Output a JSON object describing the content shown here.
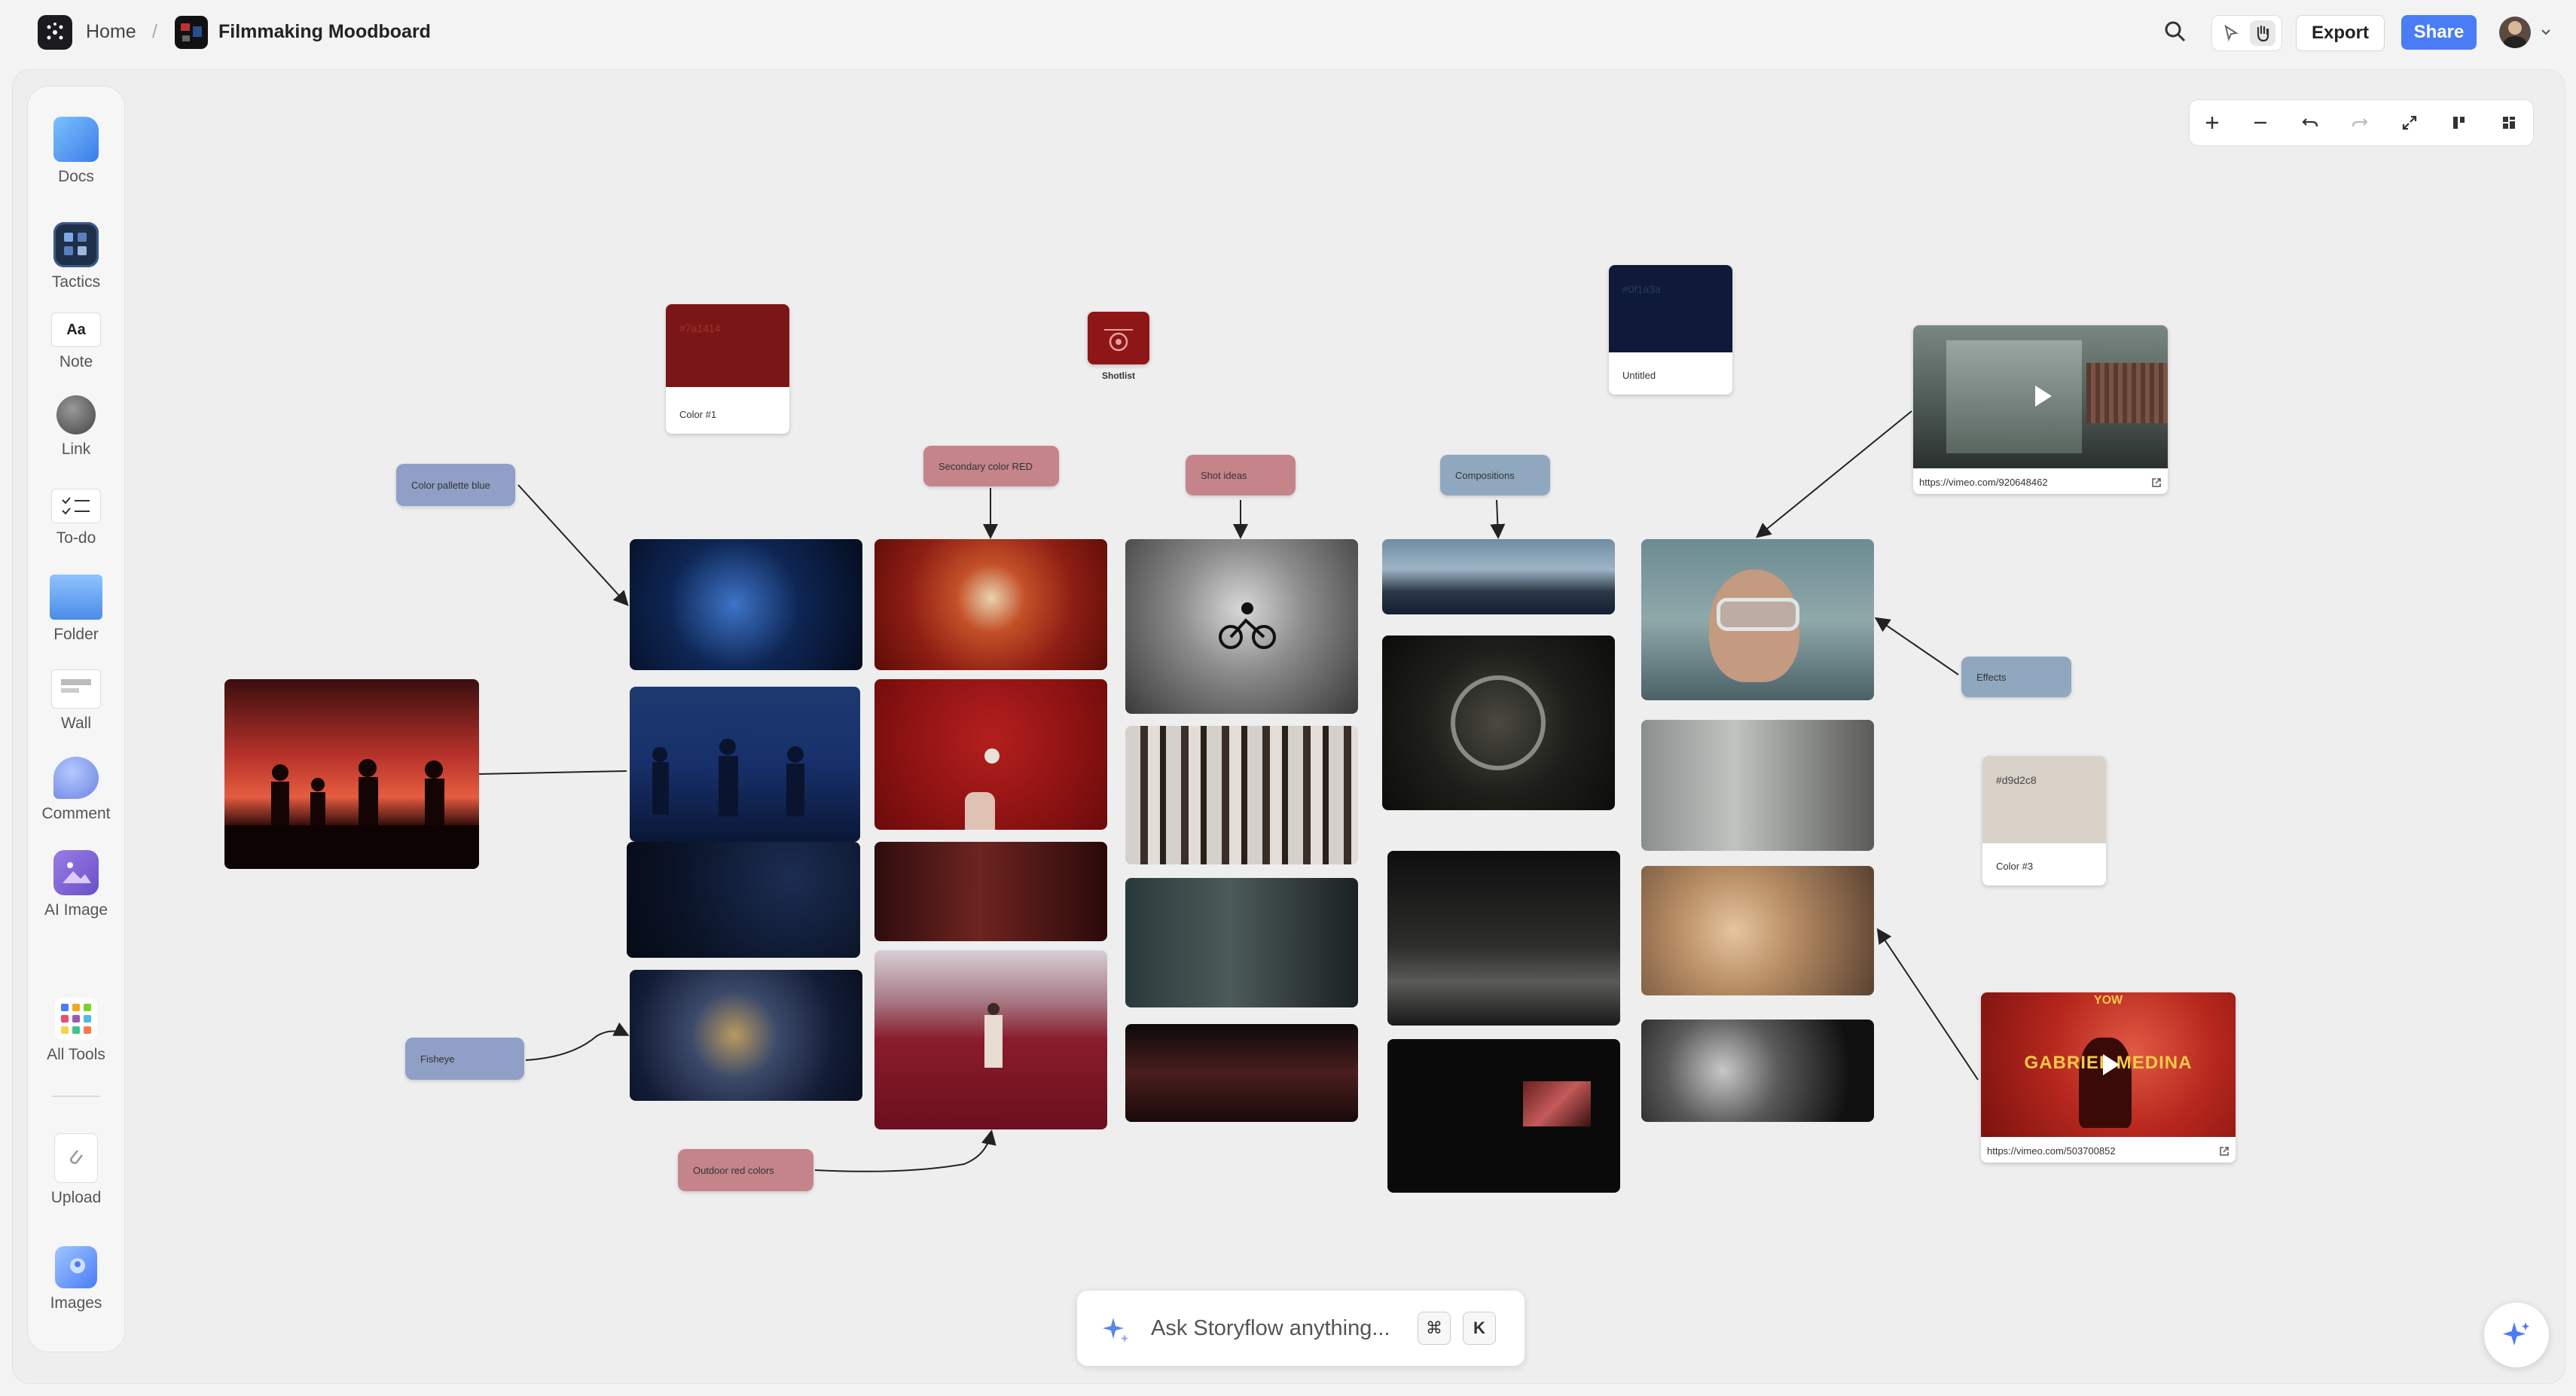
{
  "topbar": {
    "home_label": "Home",
    "separator": "/",
    "board_title": "Filmmaking Moodboard",
    "export_label": "Export",
    "share_label": "Share"
  },
  "toolbar": {
    "items": [
      {
        "label": "Docs",
        "icon": "docs-icon"
      },
      {
        "label": "Tactics",
        "icon": "tactics-icon"
      },
      {
        "label": "Note",
        "icon": "note-icon",
        "glyph": "Aa"
      },
      {
        "label": "Link",
        "icon": "link-icon"
      },
      {
        "label": "To-do",
        "icon": "todo-icon"
      },
      {
        "label": "Folder",
        "icon": "folder-icon"
      },
      {
        "label": "Wall",
        "icon": "wall-icon"
      },
      {
        "label": "Comment",
        "icon": "comment-icon"
      },
      {
        "label": "AI Image",
        "icon": "ai-image-icon"
      },
      {
        "label": "All Tools",
        "icon": "all-tools-icon"
      },
      {
        "label": "Upload",
        "icon": "upload-icon"
      },
      {
        "label": "Images",
        "icon": "images-icon"
      }
    ]
  },
  "board": {
    "labels": {
      "color_pallette_blue": "Color pallette blue",
      "secondary_color_red": "Secondary color RED",
      "shot_ideas": "Shot ideas",
      "compositions": "Compositions",
      "effects": "Effects",
      "fisheye": "Fisheye",
      "outdoor_red_colors": "Outdoor red colors"
    },
    "swatches": [
      {
        "name": "Color #1",
        "hex": "#7a1414",
        "color": "#7b1616"
      },
      {
        "name": "Untitled",
        "hex": "#0f1a3a",
        "color": "#0f1a3a"
      },
      {
        "name": "Color #3",
        "hex": "#d9d2c8",
        "color": "#d9d2c8"
      }
    ],
    "shotlist_label": "Shotlist",
    "videos": [
      {
        "url": "https://vimeo.com/920648462"
      },
      {
        "url": "https://vimeo.com/503700852",
        "overlay_top": "YOW",
        "overlay_title": "GABRIEL MEDINA"
      }
    ]
  },
  "ask": {
    "placeholder": "Ask Storyflow anything...",
    "key1": "⌘",
    "key2": "K"
  },
  "colors": {
    "accent": "#4a7cf6",
    "label_blue": "#8f9fc5",
    "label_red": "#c4848a",
    "label_teal": "#90a8bf"
  }
}
